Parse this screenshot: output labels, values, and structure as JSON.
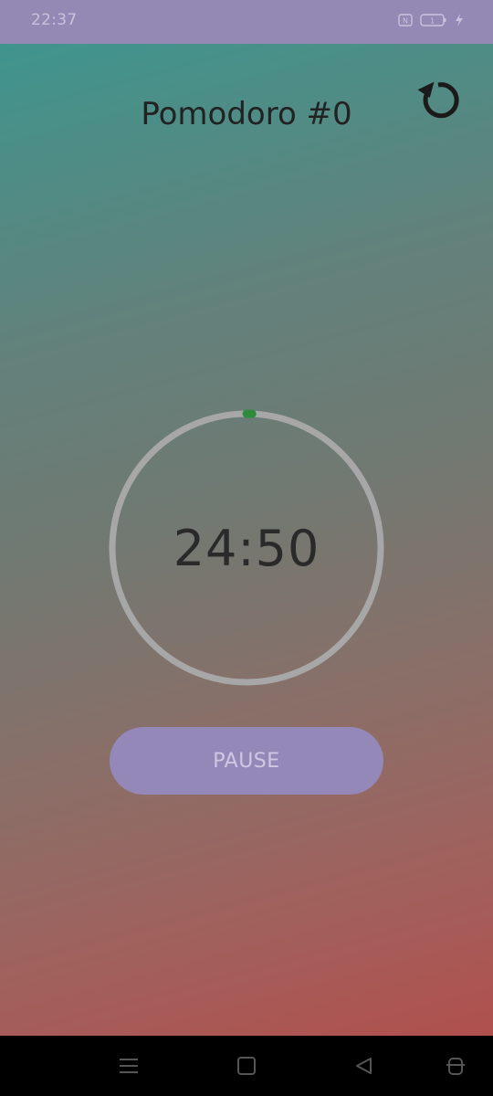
{
  "status_bar": {
    "time": "22:37",
    "battery_level": "1",
    "icons": [
      "notification-box-icon",
      "battery-icon",
      "charging-bolt-icon"
    ]
  },
  "header": {
    "title": "Pomodoro #0",
    "reset_icon": "refresh-icon"
  },
  "timer": {
    "remaining": "24:50",
    "elapsed_fraction": 0.0067
  },
  "controls": {
    "pause_label": "PAUSE"
  },
  "nav_bar": {
    "buttons": [
      "menu-icon",
      "home-icon",
      "back-icon",
      "accessibility-icon"
    ]
  },
  "colors": {
    "status_bar": "#9488b5",
    "gradient_top": "#3f958e",
    "gradient_bottom": "#b0504d",
    "ring_track": "#a7a7a7",
    "ring_progress": "#2e8b3e",
    "button": "#9488b8"
  }
}
